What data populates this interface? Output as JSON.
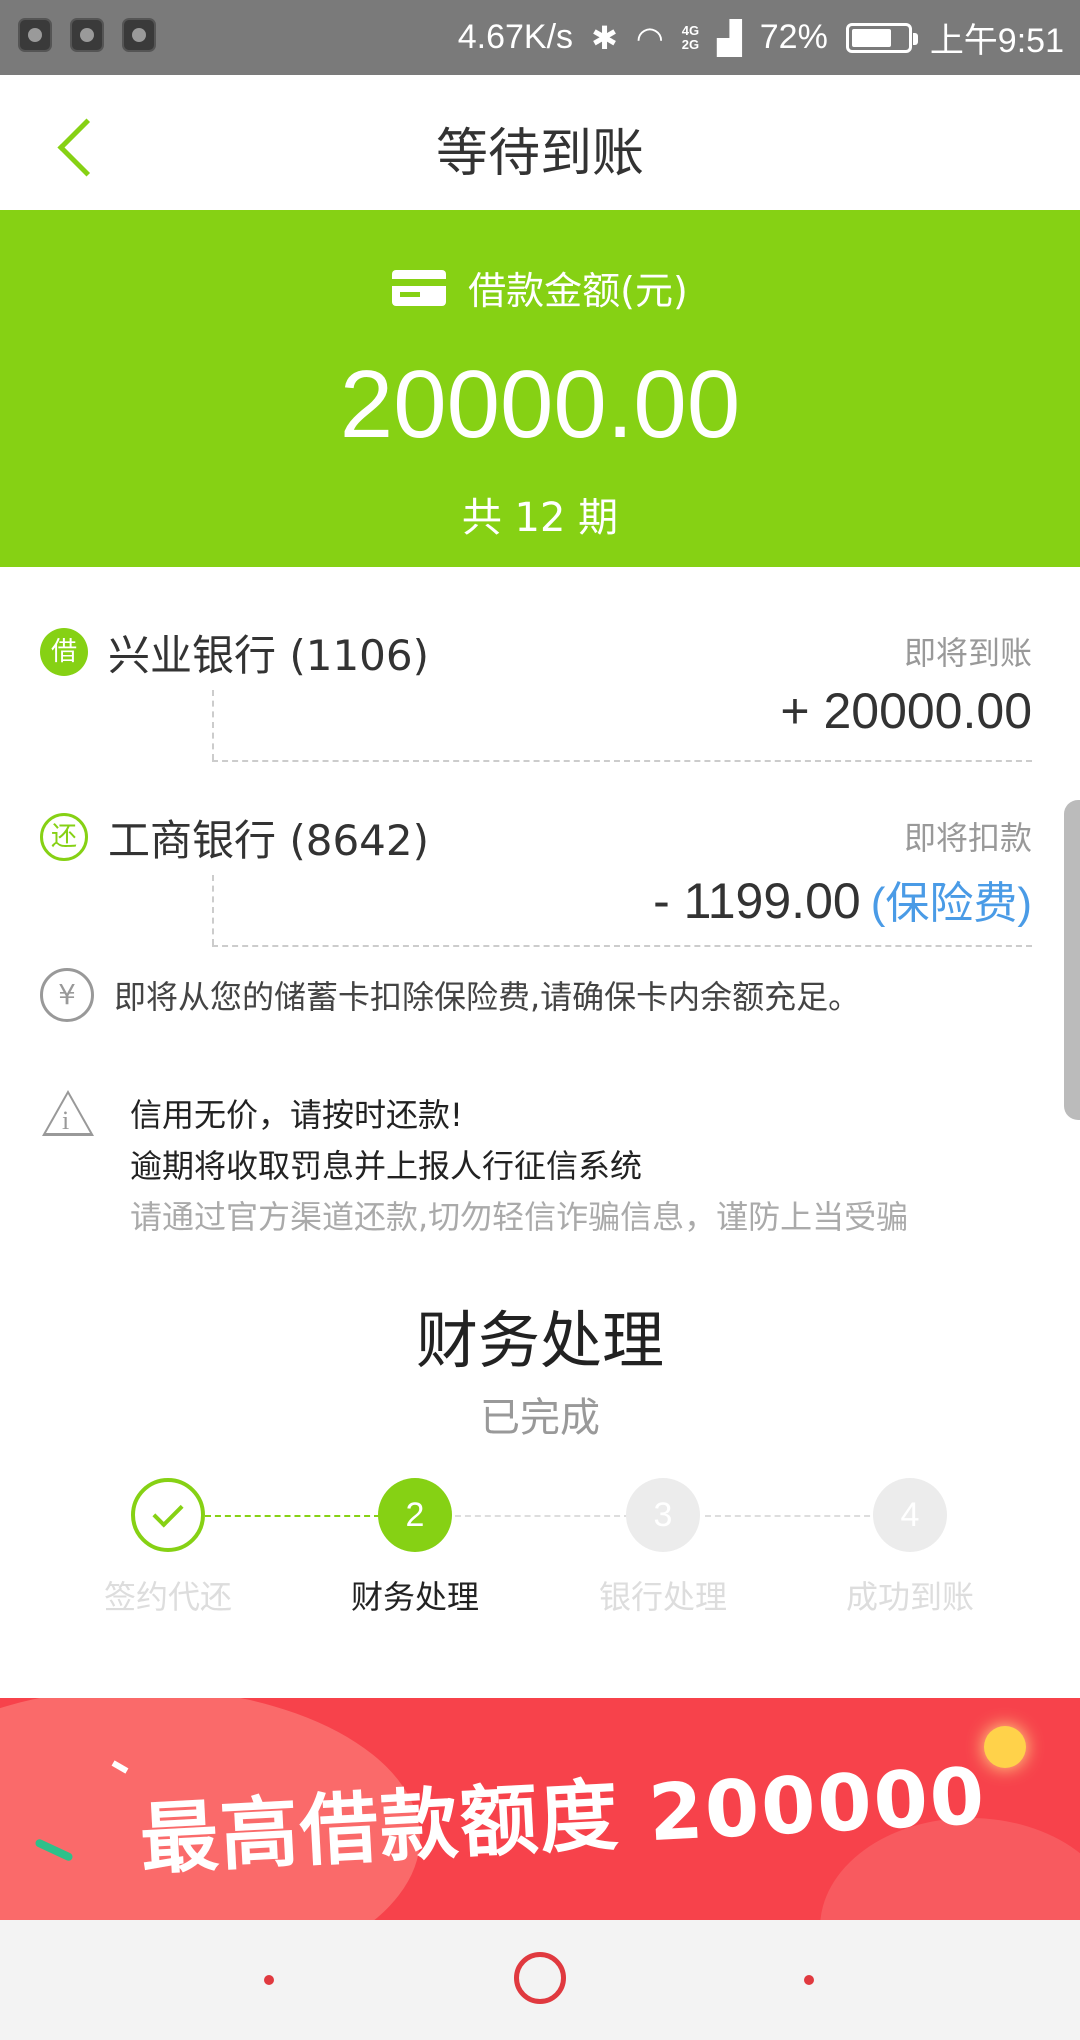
{
  "status_bar": {
    "speed": "4.67K/s",
    "net_top": "4G",
    "net_bottom": "2G",
    "battery": "72%",
    "battery_level": 0.72,
    "time": "上午9:51",
    "icons": [
      "bluetooth-icon",
      "wifi-icon",
      "signal-icon",
      "battery-icon"
    ]
  },
  "nav": {
    "title": "等待到账"
  },
  "hero": {
    "label": "借款金额(元)",
    "amount": "20000.00",
    "periods": "共 12 期",
    "color": "#86d114"
  },
  "bank_in": {
    "badge": "借",
    "name": "兴业银行 (1106)",
    "status": "即将到账",
    "amount": "+ 20000.00"
  },
  "bank_out": {
    "badge": "还",
    "name": "工商银行 (8642)",
    "status": "即将扣款",
    "amount": "- 1199.00",
    "link": "(保险费)"
  },
  "notice": {
    "icon": "¥",
    "text": "即将从您的储蓄卡扣除保险费,请确保卡内余额充足。"
  },
  "warning": {
    "line1": "信用无价，请按时还款!",
    "line2": "逾期将收取罚息并上报人行征信系统",
    "line3": "请通过官方渠道还款,切勿轻信诈骗信息，谨防上当受骗"
  },
  "stage": {
    "title": "财务处理",
    "status": "已完成"
  },
  "steps": [
    {
      "num": "",
      "label": "签约代还",
      "state": "done"
    },
    {
      "num": "2",
      "label": "财务处理",
      "state": "active"
    },
    {
      "num": "3",
      "label": "银行处理",
      "state": "pending"
    },
    {
      "num": "4",
      "label": "成功到账",
      "state": "pending"
    }
  ],
  "banner": {
    "text": "最高借款额度 200000"
  }
}
